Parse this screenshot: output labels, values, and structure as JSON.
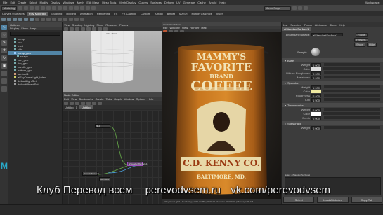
{
  "menubar": {
    "items": [
      "File",
      "Edit",
      "Create",
      "Select",
      "Modify",
      "Display",
      "Windows",
      "Mesh",
      "Edit Mesh",
      "Mesh Tools",
      "Mesh Display",
      "Curves",
      "Surfaces",
      "Deform",
      "UV",
      "Generate",
      "Cache",
      "Arnold",
      "Help"
    ],
    "workspace_label": "Workspace:"
  },
  "toolbar": {
    "mode": "Modeling",
    "live_surface": "Zeno Pogo"
  },
  "shelf": {
    "tabs": [
      "Curves / Surfaces",
      "Poly Modeling",
      "Sculpting",
      "Rigging",
      "Animation",
      "Rendering",
      "FX",
      "FX Caching",
      "Custom",
      "Arnold",
      "Bifrost",
      "MASH",
      "Motion Graphics",
      "XGen"
    ],
    "active_tab": "Poly Modeling"
  },
  "outliner": {
    "title": "Outliner",
    "menu": [
      "Display",
      "Show",
      "Help"
    ],
    "items": [
      "persp",
      "top",
      "front",
      "side",
      "bump_geo",
      "shape",
      "can_geo",
      "rim_geo",
      "handle_geo",
      "bottom_geo",
      "lambert1",
      "aiSkyDomeLight_hdrix",
      "defaultLightSet",
      "defaultObjectSet"
    ]
  },
  "viewport1": {
    "menu": [
      "View",
      "Shading",
      "Lighting",
      "Show",
      "Renderer",
      "Panels"
    ],
    "label": "side + front"
  },
  "node_editor": {
    "title": "Node Editor",
    "menu": [
      "Edit",
      "View",
      "Bookmarks",
      "Create",
      "Tabs",
      "Graph",
      "Window",
      "Options",
      "Help"
    ],
    "tabs": [
      "Untitled_1",
      "Untitled"
    ],
    "nodes": [
      "file1",
      "place2dTexture1",
      "aiStandardSurface1",
      "bump2d1"
    ]
  },
  "render_view": {
    "title": "Arnold RenderView",
    "menu": [
      "File",
      "Window",
      "View",
      "Render",
      "Help"
    ],
    "status": "aiSkyDomeLight1 | Rendering | 1920 x 1080 | 00:00:14 | Samples 3/3/3/2/2/2 | Memory 1.25 GB"
  },
  "product": {
    "line1": "MAMMY'S",
    "line2": "FAVORITE",
    "line3": "BRAND",
    "line4": "COFFEE",
    "line5": "C.D. KENNY CO.",
    "line6": "BALTIMORE, MD."
  },
  "attribute_editor": {
    "tabs": [
      "List",
      "Selected",
      "Focus",
      "Attributes",
      "Show",
      "Help"
    ],
    "node_tab": "aiStandardSurface1",
    "type_label": "aiStandardSurface:",
    "type_value": "aiStandardSurface1",
    "focus_button": "Focus",
    "presets_button": "Presets",
    "show_button": "Show",
    "hide_button": "Hide",
    "sample_label": "Sample",
    "sections": [
      {
        "title": "Base",
        "rows": [
          {
            "label": "Weight",
            "value": "1.000"
          },
          {
            "label": "Color",
            "value": ""
          },
          {
            "label": "Diffuse Roughness",
            "value": "0.000"
          },
          {
            "label": "Metalness",
            "value": "0.000"
          }
        ]
      },
      {
        "title": "Specular",
        "rows": [
          {
            "label": "Weight",
            "value": "1.000"
          },
          {
            "label": "Color",
            "value": ""
          },
          {
            "label": "Roughness",
            "value": "0.400"
          },
          {
            "label": "IOR",
            "value": "1.500"
          }
        ]
      },
      {
        "title": "Transmission",
        "rows": [
          {
            "label": "Weight",
            "value": "0.000"
          },
          {
            "label": "Color",
            "value": ""
          },
          {
            "label": "Depth",
            "value": "0.000"
          }
        ]
      },
      {
        "title": "Subsurface",
        "rows": [
          {
            "label": "Weight",
            "value": "0.000"
          }
        ]
      }
    ],
    "notes_label": "Notes: aiStandardSurface1",
    "bottom_buttons": [
      "Select",
      "Load Attributes",
      "Copy Tab"
    ]
  },
  "watermark": {
    "text1": "Клуб Перевод всем",
    "text2": "perevodvsem.ru",
    "text3": "vk.com/perevodvsem"
  },
  "colors": {
    "accent_blue": "#5285a6",
    "maya_logo": "#28a9c9",
    "can_orange": "#c7761f"
  }
}
